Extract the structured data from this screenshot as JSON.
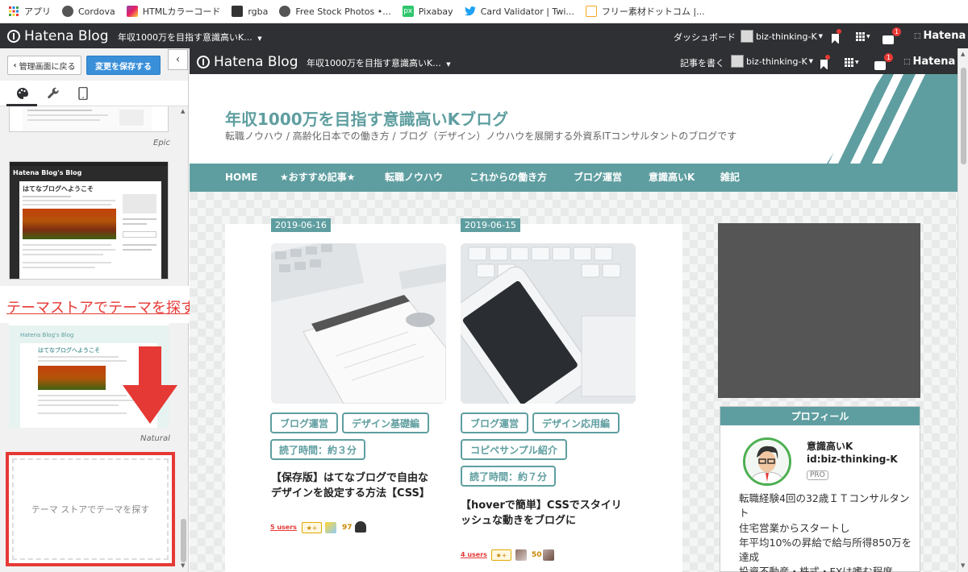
{
  "bookmarks": [
    {
      "label": "アプリ",
      "icon": "apps-grid-icon",
      "color": "#e53935"
    },
    {
      "label": "Cordova",
      "icon": "globe-icon",
      "color": "#555555"
    },
    {
      "label": "HTMLカラーコード",
      "icon": "color-palette-icon",
      "color": "#8e44ad"
    },
    {
      "label": "rgba",
      "icon": "monitor-icon",
      "color": "#333333"
    },
    {
      "label": "Free Stock Photos •...",
      "icon": "globe-icon",
      "color": "#555555"
    },
    {
      "label": "Pixabay",
      "icon": "pixabay-icon",
      "color": "#2ec66d"
    },
    {
      "label": "Card Validator | Twi...",
      "icon": "twitter-bird-icon",
      "color": "#1da1f2"
    },
    {
      "label": "フリー素材ドットコム |...",
      "icon": "bookmark-page-icon",
      "color": "#f5a623"
    }
  ],
  "topbar": {
    "logo": "Hatena Blog",
    "blog_title": "年収1000万を目指す意識高いK...",
    "dashboard": "ダッシュボード",
    "user": "biz-thinking-K",
    "notif_count": "1",
    "hatena": "Hatena"
  },
  "left": {
    "back_label": "管理画面に戻る",
    "save_label": "変更を保存する",
    "themes": [
      {
        "caption": "Epic"
      },
      {
        "caption": "",
        "preview_title": "Hatena Blog's Blog",
        "preview_heading": "はてなブログへようこそ"
      },
      {
        "caption": "Natural",
        "preview_title": "Hatena Blog's Blog",
        "preview_heading": "はてなブログへようこそ"
      }
    ],
    "annotation": "テーマストアでテーマを探すをクリック",
    "find_theme": "テーマ ストアでテーマを探す"
  },
  "preview": {
    "bar": {
      "logo": "Hatena Blog",
      "blog_title": "年収1000万を目指す意識高いK...",
      "write": "記事を書く",
      "user": "biz-thinking-K",
      "notif_count": "1",
      "hatena": "Hatena"
    },
    "title": "年収1000万を目指す意識高いKブログ",
    "description": "転職ノウハウ / 高齢化日本での働き方 / ブログ（デザイン）ノウハウを展開する外資系ITコンサルタントのブログです",
    "nav": [
      "HOME",
      "★おすすめ記事★",
      "転職ノウハウ",
      "これからの働き方",
      "ブログ運営",
      "意識高いK",
      "雑記"
    ],
    "posts": [
      {
        "date": "2019-06-16",
        "tags": [
          "ブログ運営",
          "デザイン基礎編",
          "読了時間：約３分"
        ],
        "title_lines": [
          "【保存版】はてなブログで自由な",
          "デザインを設定する方法【CSS】"
        ],
        "users": "5 users",
        "star_plus": "★+",
        "star_count": "97"
      },
      {
        "date": "2019-06-15",
        "tags": [
          "ブログ運営",
          "デザイン応用編",
          "コピペサンプル紹介",
          "読了時間：約７分"
        ],
        "title_lines": [
          "【hoverで簡単】CSSでスタイリ",
          "ッシュな動きをブログに"
        ],
        "users": "4 users",
        "star_plus": "★+",
        "star_count": "50"
      }
    ],
    "profile": {
      "heading": "プロフィール",
      "name": "意識高いK",
      "id": "id:biz-thinking-K",
      "pro": "PRO",
      "bio": [
        "転職経験4回の32歳ＩＴコンサルタン",
        "ト",
        "住宅営業からスタートし",
        "年平均10%の昇給で給与所得850万を",
        "達成",
        "投資不動産・株式・FXは嗜む程度"
      ]
    }
  },
  "colors": {
    "accent": "#5f9ea0",
    "dark_bar": "#2f3033",
    "save_button": "#3a8fd9",
    "annotation_red": "#e53935"
  }
}
